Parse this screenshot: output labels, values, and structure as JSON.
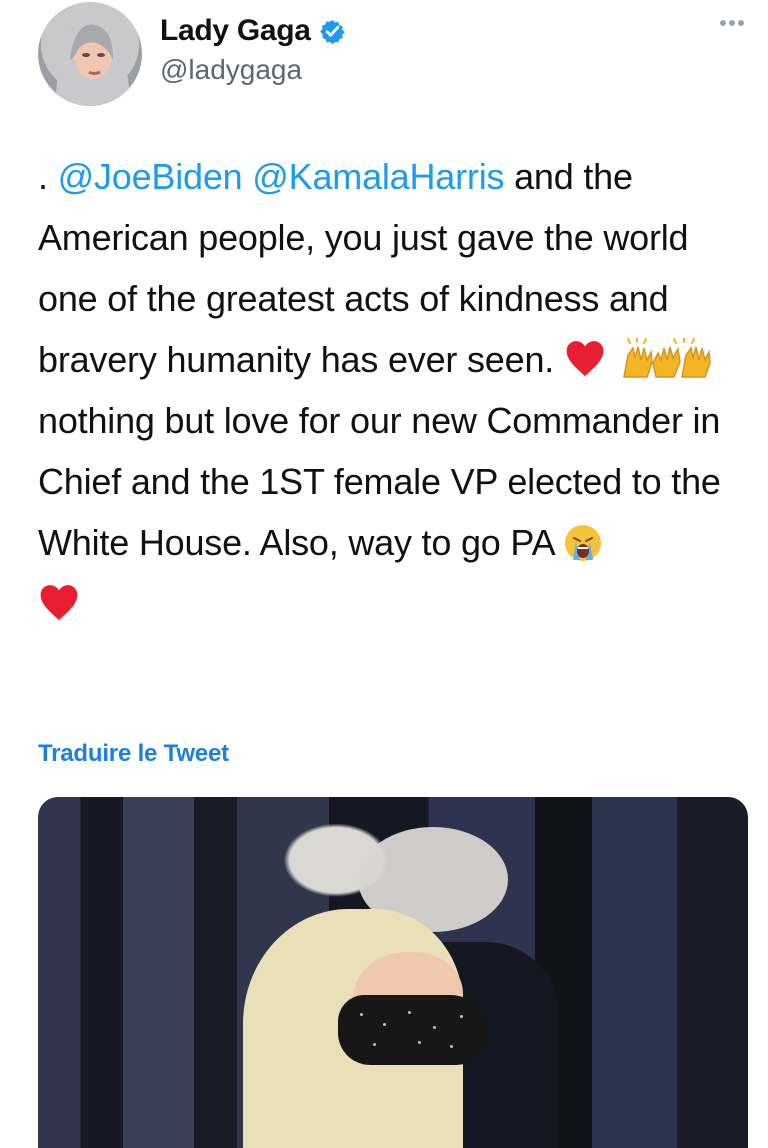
{
  "user": {
    "name": "Lady Gaga",
    "handle": "@ladygaga"
  },
  "tweet": {
    "text_parts": [
      ". ",
      "@JoeBiden",
      "@KamalaHarris",
      " and the American people, you just gave the world one of the greatest acts of kindness and bravery humanity has ever seen. ",
      " nothing but love for our new Commander in Chief and the 1ST female VP elected to the White House. Also, way to go PA "
    ]
  },
  "translate_label": "Traduire le Tweet",
  "icons": {
    "verified": "verified-badge-icon",
    "more": "more-options-icon",
    "heart": "red-heart-emoji",
    "raised_hands": "raising-hands-emoji",
    "crying_face": "loudly-crying-face-emoji"
  },
  "colors": {
    "mention": "#1d9bf0",
    "translate": "#1d7fe0",
    "heart": "#e81e31",
    "emoji_yellow": "#f4b428"
  }
}
